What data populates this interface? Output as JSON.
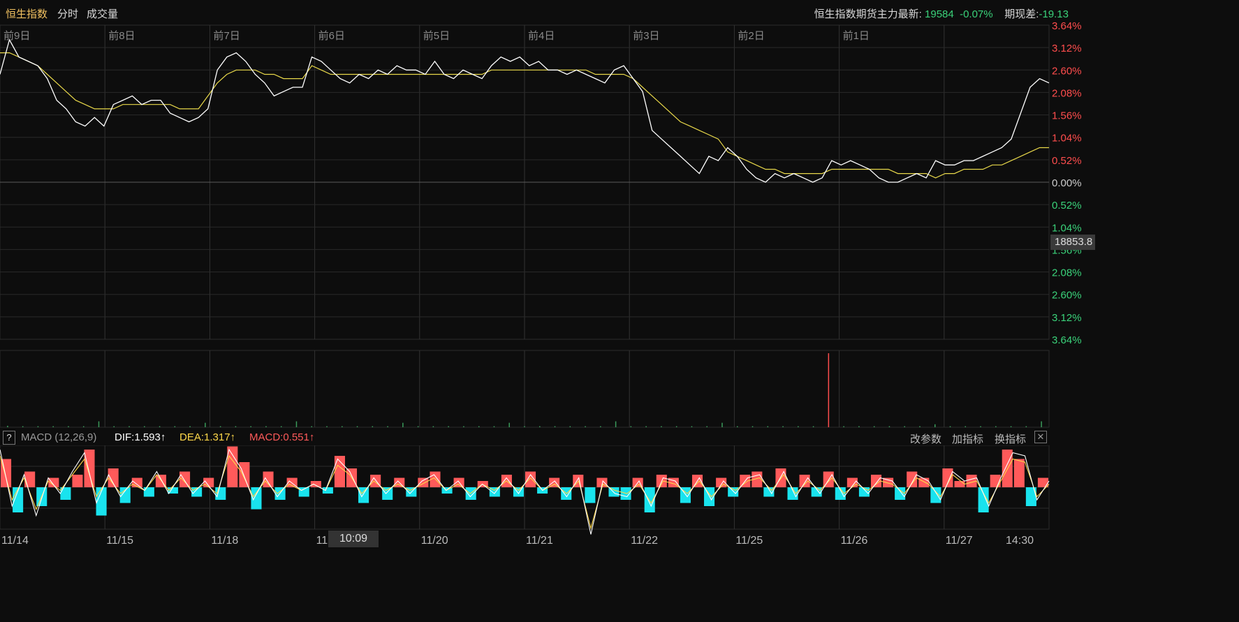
{
  "header": {
    "tabs": [
      {
        "label": "恒生指数",
        "active": true
      },
      {
        "label": "分时",
        "active": false
      },
      {
        "label": "成交量",
        "active": false
      }
    ],
    "futures_label": "恒生指数期货主力最新:",
    "futures_price": "19584",
    "futures_change": "-0.07%",
    "basis_label": "期现差:",
    "basis_value": "-19.13"
  },
  "macd": {
    "help": "?",
    "name": "MACD (12,26,9)",
    "dif": "DIF:1.593↑",
    "dea": "DEA:1.317↑",
    "macd": "MACD:0.551↑",
    "buttons": [
      "改参数",
      "加指标",
      "换指标"
    ],
    "close": "✕"
  },
  "crosshair": {
    "price_label": "18853.8",
    "time_label": "10:09"
  },
  "chart_data": {
    "type": "line",
    "day_labels": [
      "前9日",
      "前8日",
      "前7日",
      "前6日",
      "前5日",
      "前4日",
      "前3日",
      "前2日",
      "前1日"
    ],
    "x_dates": [
      "11/14",
      "11/15",
      "11/18",
      "11",
      "11/20",
      "11/21",
      "11/22",
      "11/25",
      "11/26",
      "11/27",
      "14:30"
    ],
    "y_ticks_up": [
      "3.64%",
      "3.12%",
      "2.60%",
      "2.08%",
      "1.56%",
      "1.04%",
      "0.52%"
    ],
    "y_tick_zero": "0.00%",
    "y_ticks_down": [
      "0.52%",
      "1.04%",
      "1.56%",
      "2.08%",
      "2.60%",
      "3.12%",
      "3.64%"
    ],
    "ylim": [
      -3.64,
      3.64
    ],
    "series": [
      {
        "values": [
          2.5,
          3.3,
          2.9,
          2.8,
          2.7,
          2.4,
          1.9,
          1.7,
          1.4,
          1.3,
          1.5,
          1.3,
          1.8,
          1.9,
          2.0,
          1.8,
          1.9,
          1.9,
          1.6,
          1.5,
          1.4,
          1.5,
          1.7,
          2.6,
          2.9,
          3.0,
          2.8,
          2.5,
          2.3,
          2.0,
          2.1,
          2.2,
          2.2,
          2.9,
          2.8,
          2.6,
          2.4,
          2.3,
          2.5,
          2.4,
          2.6,
          2.5,
          2.7,
          2.6,
          2.6,
          2.5,
          2.8,
          2.5,
          2.4,
          2.6,
          2.5,
          2.4,
          2.7,
          2.9,
          2.8,
          2.9,
          2.7,
          2.8,
          2.6,
          2.6,
          2.5,
          2.6,
          2.5,
          2.4,
          2.3,
          2.6,
          2.7,
          2.4,
          2.1,
          1.2,
          1.0,
          0.8,
          0.6,
          0.4,
          0.2,
          0.6,
          0.5,
          0.8,
          0.6,
          0.3,
          0.1,
          0.0,
          0.2,
          0.1,
          0.2,
          0.1,
          0.0,
          0.1,
          0.5,
          0.4,
          0.5,
          0.4,
          0.3,
          0.1,
          0.0,
          0.0,
          0.1,
          0.2,
          0.1,
          0.5,
          0.4,
          0.4,
          0.5,
          0.5,
          0.6,
          0.7,
          0.8,
          1.0,
          1.6,
          2.2,
          2.4,
          2.3
        ]
      },
      {
        "values": [
          3.0,
          3.0,
          2.9,
          2.8,
          2.7,
          2.5,
          2.3,
          2.1,
          1.9,
          1.8,
          1.7,
          1.7,
          1.7,
          1.8,
          1.8,
          1.8,
          1.8,
          1.8,
          1.8,
          1.7,
          1.7,
          1.7,
          2.0,
          2.3,
          2.5,
          2.6,
          2.6,
          2.6,
          2.5,
          2.5,
          2.4,
          2.4,
          2.4,
          2.7,
          2.6,
          2.5,
          2.5,
          2.5,
          2.5,
          2.5,
          2.5,
          2.5,
          2.5,
          2.5,
          2.5,
          2.5,
          2.5,
          2.5,
          2.5,
          2.5,
          2.5,
          2.5,
          2.6,
          2.6,
          2.6,
          2.6,
          2.6,
          2.6,
          2.6,
          2.6,
          2.6,
          2.6,
          2.6,
          2.5,
          2.5,
          2.5,
          2.5,
          2.4,
          2.2,
          2.0,
          1.8,
          1.6,
          1.4,
          1.3,
          1.2,
          1.1,
          1.0,
          0.7,
          0.6,
          0.5,
          0.4,
          0.3,
          0.3,
          0.2,
          0.2,
          0.2,
          0.2,
          0.2,
          0.3,
          0.3,
          0.3,
          0.3,
          0.3,
          0.3,
          0.3,
          0.2,
          0.2,
          0.2,
          0.2,
          0.1,
          0.2,
          0.2,
          0.3,
          0.3,
          0.3,
          0.4,
          0.4,
          0.5,
          0.6,
          0.7,
          0.8,
          0.8
        ]
      }
    ],
    "volume": [
      2,
      1,
      1,
      1,
      1,
      1,
      8,
      1,
      1,
      1,
      1,
      1,
      1,
      6,
      1,
      1,
      1,
      1,
      1,
      8,
      1,
      1,
      1,
      1,
      1,
      1,
      6,
      1,
      1,
      1,
      1,
      1,
      1,
      6,
      1,
      1,
      1,
      1,
      1,
      1,
      8,
      1,
      1,
      1,
      1,
      1,
      1,
      6,
      1,
      1,
      1,
      1,
      1,
      1,
      100,
      1,
      1,
      1,
      1,
      1,
      1,
      4,
      1,
      1,
      1,
      1,
      1,
      1,
      8
    ],
    "macd_hist": [
      0.9,
      -0.8,
      0.5,
      -0.6,
      0.3,
      -0.4,
      0.4,
      1.2,
      -0.9,
      0.6,
      -0.5,
      0.3,
      -0.3,
      0.4,
      -0.2,
      0.5,
      -0.3,
      0.3,
      -0.4,
      1.3,
      0.8,
      -0.7,
      0.5,
      -0.4,
      0.3,
      -0.3,
      0.2,
      -0.2,
      1.0,
      0.6,
      -0.5,
      0.4,
      -0.4,
      0.3,
      -0.3,
      0.3,
      0.5,
      -0.2,
      0.3,
      -0.4,
      0.2,
      -0.3,
      0.4,
      -0.3,
      0.5,
      -0.2,
      0.3,
      -0.4,
      0.4,
      -0.5,
      0.3,
      -0.3,
      -0.4,
      0.3,
      -0.8,
      0.4,
      0.3,
      -0.5,
      0.4,
      -0.6,
      0.3,
      -0.3,
      0.4,
      0.5,
      -0.3,
      0.6,
      -0.4,
      0.4,
      -0.3,
      0.5,
      -0.4,
      0.3,
      -0.3,
      0.4,
      0.3,
      -0.4,
      0.5,
      0.3,
      -0.5,
      0.6,
      0.2,
      0.4,
      -0.8,
      0.4,
      1.2,
      0.9,
      -0.6,
      0.3
    ],
    "macd_dif": [
      1.2,
      -0.6,
      0.4,
      -0.9,
      0.3,
      -0.2,
      0.5,
      1.1,
      -0.5,
      0.4,
      -0.3,
      0.2,
      -0.1,
      0.5,
      -0.2,
      0.4,
      -0.2,
      0.2,
      -0.3,
      1.2,
      0.6,
      -0.4,
      0.3,
      -0.3,
      0.2,
      -0.1,
      0.1,
      -0.1,
      0.9,
      0.5,
      -0.3,
      0.3,
      -0.2,
      0.2,
      -0.2,
      0.2,
      0.4,
      -0.1,
      0.2,
      -0.3,
      0.1,
      -0.2,
      0.3,
      -0.2,
      0.4,
      -0.1,
      0.2,
      -0.3,
      0.3,
      -1.5,
      0.2,
      -0.2,
      -0.3,
      0.2,
      -0.6,
      0.3,
      0.2,
      -0.3,
      0.3,
      -0.4,
      0.2,
      -0.2,
      0.3,
      0.4,
      -0.2,
      0.5,
      -0.3,
      0.3,
      -0.2,
      0.4,
      -0.3,
      0.2,
      -0.2,
      0.3,
      0.2,
      -0.3,
      0.4,
      0.2,
      -0.4,
      0.5,
      0.2,
      0.3,
      -0.6,
      0.3,
      1.1,
      1.0,
      -0.4,
      0.2
    ],
    "macd_dea": [
      1.0,
      -0.4,
      0.3,
      -0.7,
      0.2,
      -0.1,
      0.4,
      0.9,
      -0.3,
      0.3,
      -0.2,
      0.1,
      -0.1,
      0.4,
      -0.1,
      0.3,
      -0.1,
      0.1,
      -0.2,
      1.0,
      0.5,
      -0.3,
      0.2,
      -0.2,
      0.1,
      -0.1,
      0.1,
      -0.1,
      0.7,
      0.4,
      -0.2,
      0.2,
      -0.1,
      0.1,
      -0.1,
      0.1,
      0.3,
      -0.1,
      0.1,
      -0.2,
      0.1,
      -0.1,
      0.2,
      -0.1,
      0.3,
      -0.1,
      0.1,
      -0.2,
      0.2,
      -1.3,
      0.1,
      -0.1,
      -0.2,
      0.1,
      -0.5,
      0.2,
      0.1,
      -0.2,
      0.2,
      -0.3,
      0.1,
      -0.1,
      0.2,
      0.3,
      -0.1,
      0.4,
      -0.2,
      0.2,
      -0.1,
      0.3,
      -0.2,
      0.1,
      -0.1,
      0.2,
      0.1,
      -0.2,
      0.3,
      0.1,
      -0.3,
      0.4,
      0.1,
      0.2,
      -0.5,
      0.2,
      0.9,
      0.8,
      -0.3,
      0.1
    ]
  },
  "colors": {
    "price_line": "#ffffff",
    "avg_line": "#e8d84a",
    "up": "#ff4d4d",
    "down": "#3ad27a",
    "macd_up": "#ff5a5a",
    "macd_down": "#19e3ee",
    "dea": "#ffd84a",
    "dif": "#ffffff",
    "grid": "#2a2a2a",
    "tab_active": "#f0c060"
  }
}
